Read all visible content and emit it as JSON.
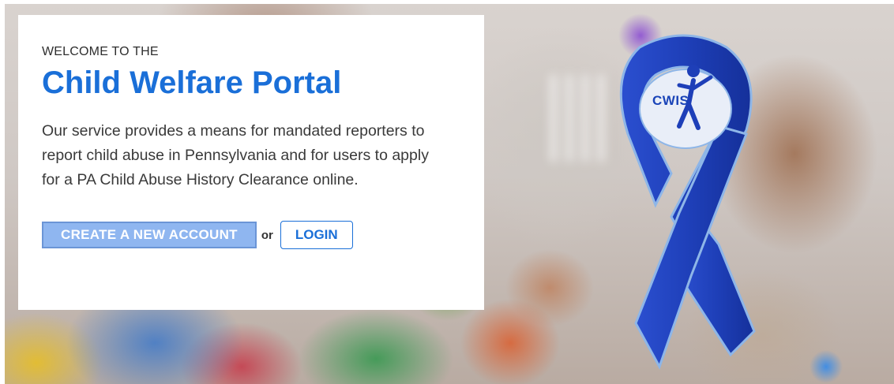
{
  "hero": {
    "eyebrow": "WELCOME TO THE",
    "title": "Child Welfare Portal",
    "description": "Our service provides a means for mandated reporters to report child abuse in Pennsylvania and for users to apply for a PA Child Abuse History Clearance online.",
    "create_account_label": "CREATE A NEW ACCOUNT",
    "or_label": "or",
    "login_label": "LOGIN"
  },
  "logo": {
    "text": "CWIS"
  },
  "colors": {
    "brand_blue": "#1a6fd8",
    "create_button": "#8fb6f0",
    "ribbon_blue": "#1e3fb8"
  }
}
